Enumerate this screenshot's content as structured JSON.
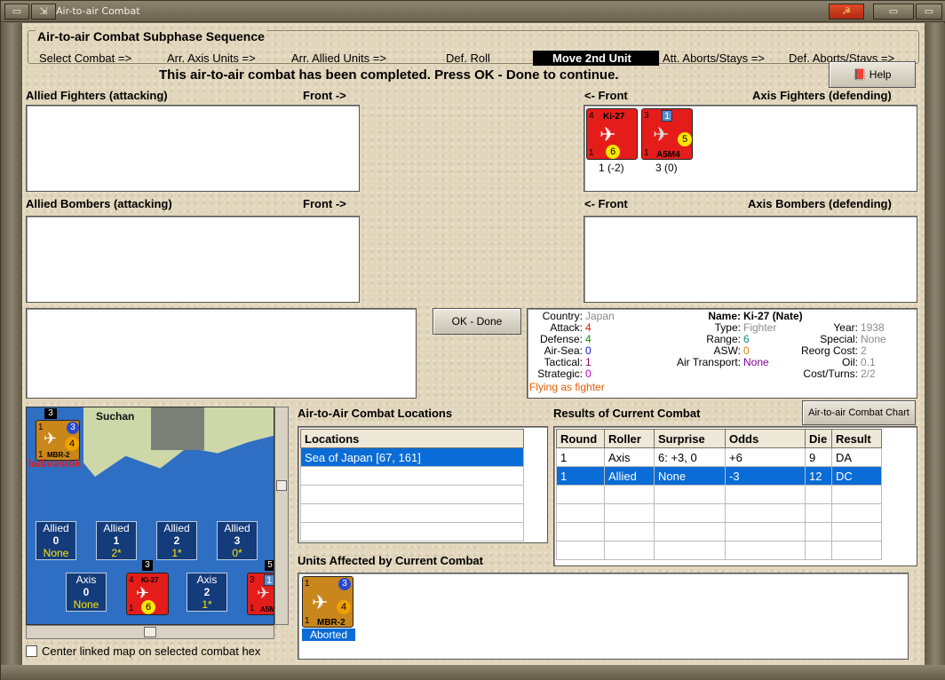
{
  "window": {
    "title": "Air-to-air Combat"
  },
  "phase": {
    "title": "Air-to-air Combat Subphase Sequence",
    "items": [
      "Select Combat =>",
      "Arr. Axis Units =>",
      "Arr. Allied Units =>",
      "Def. Roll",
      "Move 2nd Unit",
      "Att. Aborts/Stays =>",
      "Def. Aborts/Stays =>"
    ],
    "active_index": 4
  },
  "message": "This air-to-air combat has been completed.  Press OK - Done to continue.",
  "help_label": "Help",
  "sections": {
    "allied_fighters": "Allied Fighters (attacking)",
    "allied_fighters_front": "Front ->",
    "axis_fighters_front": "<- Front",
    "axis_fighters": "Axis Fighters (defending)",
    "allied_bombers": "Allied Bombers (attacking)",
    "allied_bombers_front": "Front ->",
    "axis_bombers_front": "<- Front",
    "axis_bombers": "Axis Bombers (defending)"
  },
  "axis_fighters_units": [
    {
      "name": "Ki-27",
      "top_left": "4",
      "bottom_left": "1",
      "badge": "6",
      "caption": "1 (-2)"
    },
    {
      "name": "A5M4",
      "top_left": "3",
      "bottom_left": "1",
      "badge": "5",
      "flag": "1",
      "caption": "3 (0)"
    }
  ],
  "ok_button": "OK - Done",
  "unit_info": {
    "country_label": "Country:",
    "country": "Japan",
    "attack_label": "Attack:",
    "attack": "4",
    "defense_label": "Defense:",
    "defense": "4",
    "airsea_label": "Air-Sea:",
    "airsea": "0",
    "tactical_label": "Tactical:",
    "tactical": "1",
    "strategic_label": "Strategic:",
    "strategic": "0",
    "flying": "Flying as fighter",
    "name_label": "Name:",
    "name": "Ki-27 (Nate)",
    "type_label": "Type:",
    "type": "Fighter",
    "range_label": "Range:",
    "range": "6",
    "asw_label": "ASW:",
    "asw": "0",
    "air_transport_label": "Air Transport:",
    "air_transport": "None",
    "year_label": "Year:",
    "year": "1938",
    "special_label": "Special:",
    "special": "None",
    "reorg_label": "Reorg Cost:",
    "reorg": "2",
    "oil_label": "Oil:",
    "oil": "0.1",
    "cost_label": "Cost/Turns:",
    "cost": "2/2",
    "colors": {
      "country": "#8a8a8a",
      "attack": "#e01010",
      "defense": "#108a10",
      "airsea": "#1010d0",
      "tactical": "#9a0060",
      "strategic": "#c800c8",
      "flying": "#e05a00",
      "range": "#108a8a",
      "asw": "#e08000",
      "air_transport": "#8000a0",
      "gray": "#8a8a8a"
    }
  },
  "map": {
    "place_top": "Suchan",
    "place_left": "ladivostok",
    "hex_stack": "3",
    "counter": {
      "name": "MBR-2",
      "top_left": "1",
      "bottom_left": "1",
      "badge": "4",
      "circle": "3"
    },
    "allied_slots": [
      {
        "label": "Allied",
        "num": "0",
        "sub": "None"
      },
      {
        "label": "Allied",
        "num": "1",
        "sub": "2*"
      },
      {
        "label": "Allied",
        "num": "2",
        "sub": "1*"
      },
      {
        "label": "Allied",
        "num": "3",
        "sub": "0*"
      }
    ],
    "axis_slots": [
      {
        "label": "Axis",
        "num": "0",
        "sub": "None"
      },
      {
        "label": "Axis",
        "num": "2",
        "sub": "1*"
      }
    ],
    "axis_counter_1": {
      "name": "Ki-27",
      "top_left": "4",
      "bottom_left": "1",
      "badge": "6",
      "stack": "3"
    },
    "axis_counter_2": {
      "name": "A5M",
      "top_left": "3",
      "bottom_left": "1",
      "flag": "1",
      "stack": "5"
    }
  },
  "center_checkbox_label": "Center linked map on selected combat hex",
  "locations": {
    "title": "Air-to-Air Combat Locations",
    "header": "Locations",
    "rows": [
      "Sea of Japan [67, 161]"
    ]
  },
  "results": {
    "title": "Results of Current Combat",
    "chart_button": "Air-to-air Combat Chart",
    "headers": [
      "Round",
      "Roller",
      "Surprise",
      "Odds",
      "Die",
      "Result"
    ],
    "rows": [
      [
        "1",
        "Axis",
        "6: +3, 0",
        "+6",
        "9",
        "DA"
      ],
      [
        "1",
        "Allied",
        "None",
        "-3",
        "12",
        "DC"
      ]
    ],
    "selected_row": 1
  },
  "affected": {
    "title": "Units Affected by Current Combat",
    "unit": {
      "name": "MBR-2",
      "top_left": "1",
      "bottom_left": "1",
      "badge": "4",
      "circle": "3",
      "status": "Aborted"
    }
  }
}
